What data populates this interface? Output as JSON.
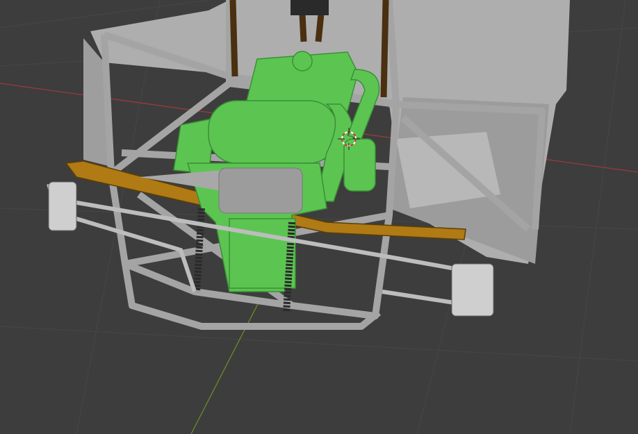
{
  "viewport": {
    "background": "#3d3d3d",
    "grid_color": "#474747",
    "x_axis_color": "#a03a3a",
    "y_axis_color": "#6b8a2a"
  },
  "model": {
    "frame_color": "#a8a8a8",
    "body_color": "#b4b4b4",
    "engine_color": "#5cc552",
    "spring_color": "#b07a14",
    "shock_color": "#2a2a2a",
    "exhaust_color": "#9a9a9a"
  },
  "cursor": {
    "icon": "3d-cursor-icon",
    "ring_color": "#e03030"
  }
}
